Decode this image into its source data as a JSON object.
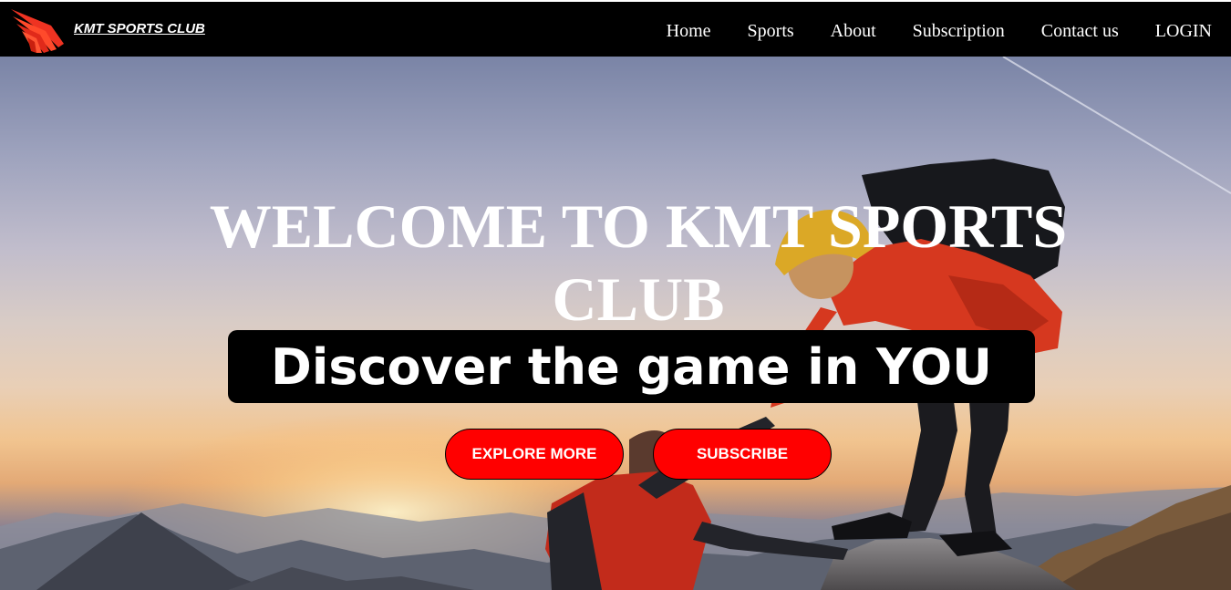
{
  "brand": {
    "name": "KMT SPORTS CLUB",
    "logo_icon": "winged-logo-icon",
    "accent_color": "#ff0000"
  },
  "nav": {
    "items": [
      {
        "label": "Home"
      },
      {
        "label": "Sports"
      },
      {
        "label": "About"
      },
      {
        "label": "Subscription"
      },
      {
        "label": "Contact us"
      },
      {
        "label": "LOGIN"
      }
    ]
  },
  "hero": {
    "title": "WELCOME TO KMT SPORTS CLUB",
    "tagline": "Discover the game in YOU",
    "explore_label": "EXPLORE MORE",
    "subscribe_label": "SUBSCRIBE",
    "background": "mountain-climbers-sunset-photo"
  }
}
